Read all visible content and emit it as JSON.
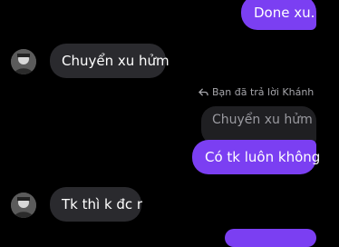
{
  "messages": {
    "m1": "Done xu.",
    "m2": "Chuyển xu hửm",
    "reply_note": "Bạn đã trả lời Khánh",
    "quoted": "Chuyển xu hửm",
    "m3": "Có tk luôn không",
    "m4": "Tk thì k đc r"
  },
  "colors": {
    "outgoing_bubble": "#7b3ff2",
    "incoming_bubble": "#2a2a2e",
    "background": "#000000"
  },
  "icons": {
    "reply": "reply-arrow-icon",
    "avatar": "contact-avatar"
  }
}
